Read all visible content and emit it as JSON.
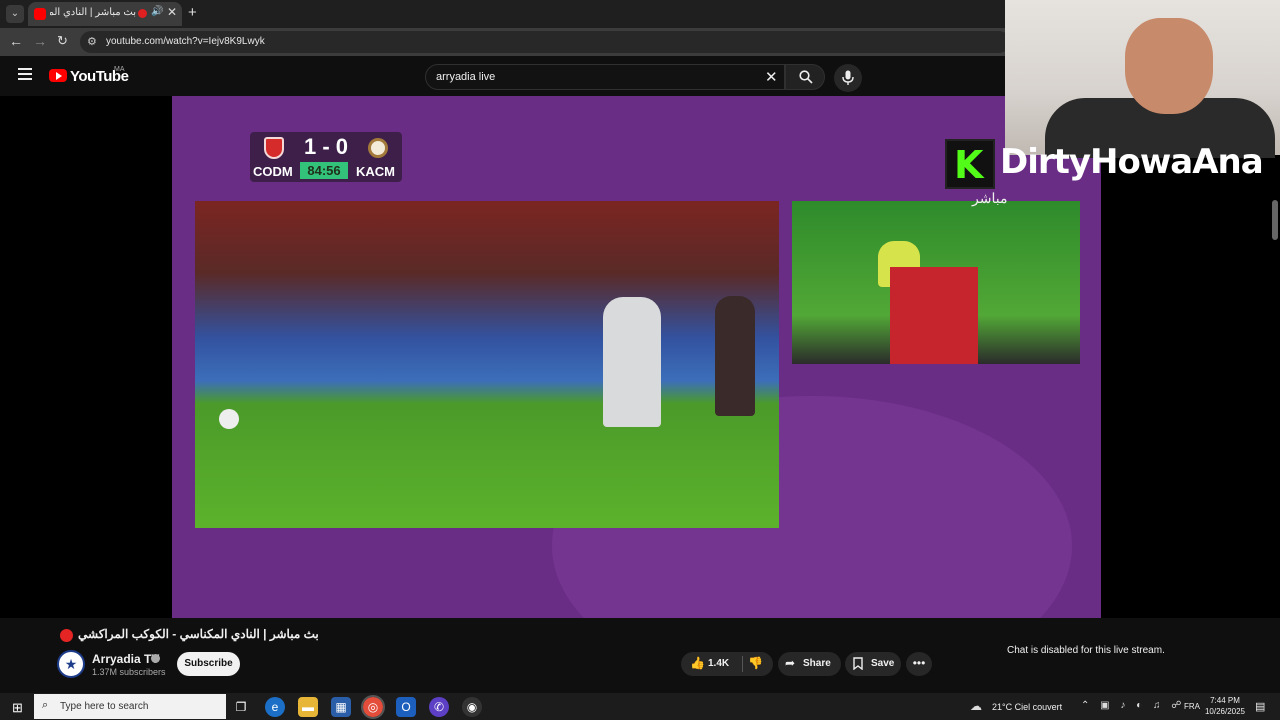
{
  "browser": {
    "tab_title": "بث مباشر | النادي المكناسي - الكوكب المراكشي",
    "url": "youtube.com/watch?v=Iejv8K9Lwyk"
  },
  "header": {
    "wordmark": "YouTube",
    "region": "MA",
    "search_value": "arryadia live"
  },
  "broadcast": {
    "score": "1 - 0",
    "home_abbr": "CODM",
    "away_abbr": "KACM",
    "clock": "84:56",
    "live_arabic": "مباشر"
  },
  "streamer": {
    "channel_name": "DirtyHowaAna",
    "kick_letter": "K"
  },
  "video": {
    "title": "بث مباشر | النادي المكناسي - الكوكب المراكشي",
    "channel": "Arryadia TV",
    "subscribers": "1.37M subscribers",
    "subscribe_label": "Subscribe",
    "likes": "1.4K",
    "share_label": "Share",
    "save_label": "Save",
    "chat_status": "Chat is disabled for this live stream."
  },
  "taskbar": {
    "search_placeholder": "Type here to search",
    "weather": "21°C  Ciel couvert",
    "language": "FRA",
    "time": "7:44 PM",
    "date": "10/26/2025"
  },
  "colors": {
    "youtube_red": "#ff0000",
    "kick_green": "#53fc18",
    "broadcast_purple": "#6a2d86",
    "clock_green": "#33c27a"
  }
}
